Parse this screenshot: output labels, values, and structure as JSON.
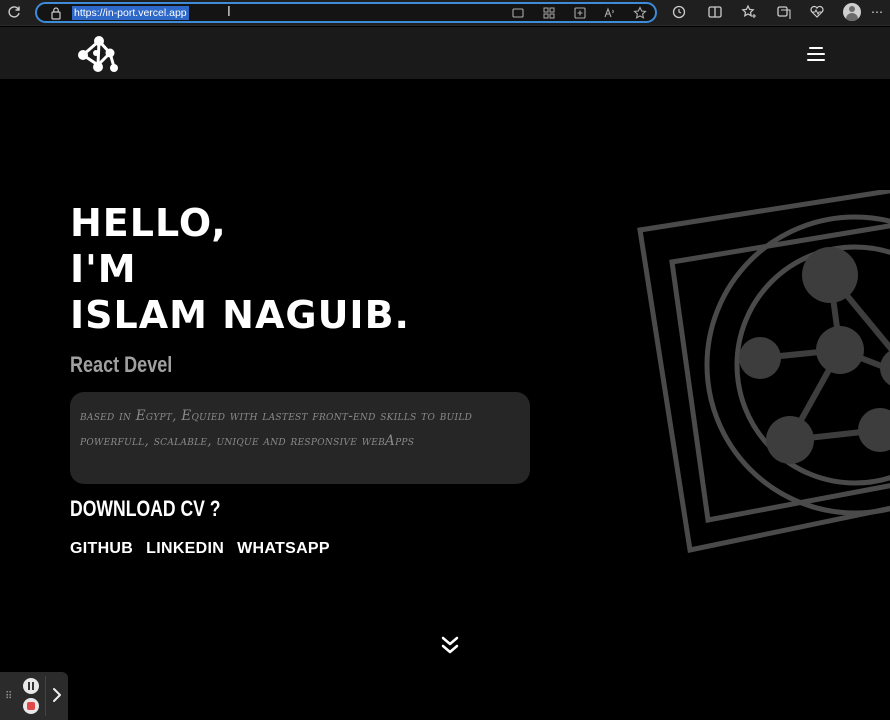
{
  "browser": {
    "url": "https://in-port.vercel.app",
    "menu_glyph": "⋯",
    "icons": [
      "reload-icon",
      "lock-icon",
      "cast-icon",
      "apps-icon",
      "add-tab-icon",
      "read-aloud-icon",
      "favorite-star-icon",
      "extensions-icon",
      "split-screen-icon",
      "favorites-icon",
      "collections-icon",
      "heart-monitor-icon",
      "profile-avatar"
    ]
  },
  "site": {
    "logo_name": "network-nodes-logo",
    "nav_icon": "hamburger-menu-icon"
  },
  "hero": {
    "line1": "HELLO,",
    "line2": "I'M",
    "line3": "ISLAM NAGUIB.",
    "role": "React Devel",
    "about": "based in Egypt, Equied with lastest front-end skills to build powerfull, scalable, unique and responsive webApps",
    "download_label": "DOWNLOAD CV ?",
    "links": [
      "GITHUB",
      "LINKEDIN",
      "WHATSAPP"
    ]
  },
  "recorder": {
    "grip_glyph": "⠿"
  },
  "colors": {
    "background": "#000000",
    "header": "#1a1a1a",
    "accent_url_selection": "#2e68c8",
    "about_box": "#262626",
    "muted_text": "#8a8a8a"
  }
}
